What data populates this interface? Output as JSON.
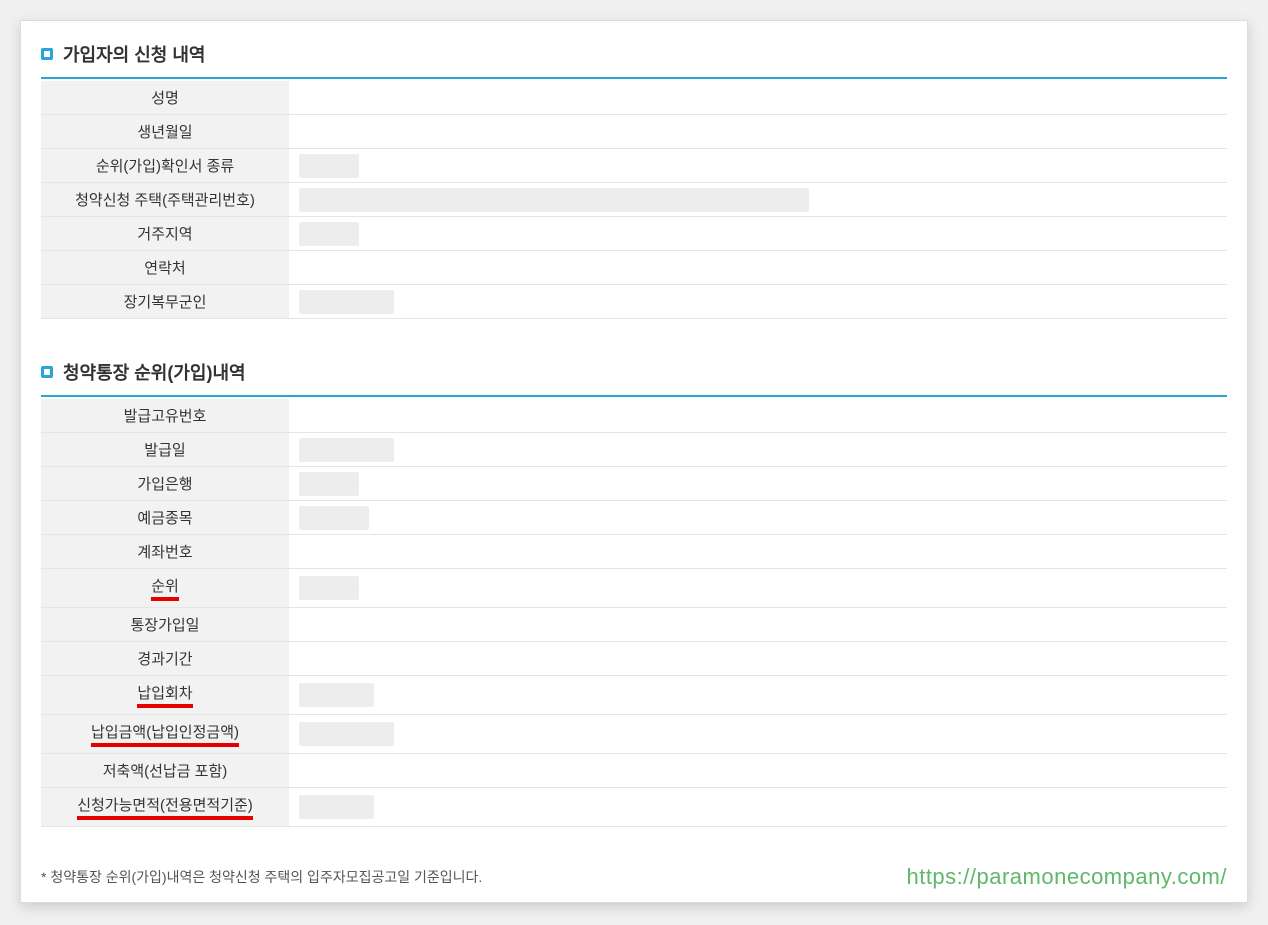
{
  "section1": {
    "title": "가입자의 신청 내역",
    "rows": [
      {
        "label": "성명",
        "blurWidth": 0,
        "underline": false
      },
      {
        "label": "생년월일",
        "blurWidth": 0,
        "underline": false
      },
      {
        "label": "순위(가입)확인서 종류",
        "blurWidth": 60,
        "underline": false
      },
      {
        "label": "청약신청 주택(주택관리번호)",
        "blurWidth": 510,
        "underline": false
      },
      {
        "label": "거주지역",
        "blurWidth": 60,
        "underline": false
      },
      {
        "label": "연락처",
        "blurWidth": 0,
        "underline": false
      },
      {
        "label": "장기복무군인",
        "blurWidth": 95,
        "underline": false
      }
    ]
  },
  "section2": {
    "title": "청약통장 순위(가입)내역",
    "rows": [
      {
        "label": "발급고유번호",
        "blurWidth": 0,
        "underline": false
      },
      {
        "label": "발급일",
        "blurWidth": 95,
        "underline": false
      },
      {
        "label": "가입은행",
        "blurWidth": 60,
        "underline": false
      },
      {
        "label": "예금종목",
        "blurWidth": 70,
        "underline": false
      },
      {
        "label": "계좌번호",
        "blurWidth": 0,
        "underline": false
      },
      {
        "label": "순위",
        "blurWidth": 60,
        "underline": true
      },
      {
        "label": "통장가입일",
        "blurWidth": 0,
        "underline": false
      },
      {
        "label": "경과기간",
        "blurWidth": 0,
        "underline": false
      },
      {
        "label": "납입회차",
        "blurWidth": 75,
        "underline": true
      },
      {
        "label": "납입금액(납입인정금액)",
        "blurWidth": 95,
        "underline": true
      },
      {
        "label": "저축액(선납금 포함)",
        "blurWidth": 0,
        "underline": false
      },
      {
        "label": "신청가능면적(전용면적기준)",
        "blurWidth": 75,
        "underline": true
      }
    ]
  },
  "footnote": "* 청약통장 순위(가입)내역은 청약신청 주택의 입주자모집공고일 기준입니다.",
  "watermark": "https://paramonecompany.com/"
}
